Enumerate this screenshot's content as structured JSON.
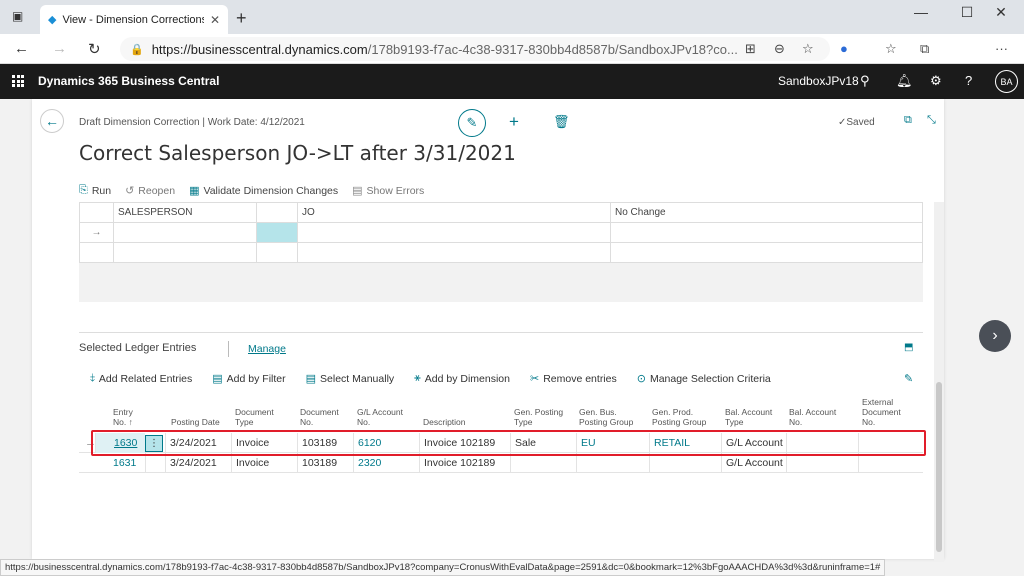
{
  "browser": {
    "tab_title": "View - Dimension Corrections - D",
    "url_host": "https://businesscentral.dynamics.com",
    "url_rest": "/178b9193-f7ac-4c38-9317-830bb4d8587b/SandboxJPv18?co..."
  },
  "app": {
    "name": "Dynamics 365 Business Central",
    "environment": "SandboxJPv18",
    "user_initials": "BA"
  },
  "page": {
    "breadcrumb": "Draft Dimension Correction | Work Date: 4/12/2021",
    "title": "Correct Salesperson JO->LT after 3/31/2021",
    "status": "✓Saved"
  },
  "actions": {
    "run": "Run",
    "reopen": "Reopen",
    "validate": "Validate Dimension Changes",
    "show_errors": "Show Errors"
  },
  "dimension_grid": {
    "rows": [
      {
        "code": "SALESPERSON",
        "value": "JO",
        "new_value": "No Change"
      }
    ]
  },
  "ledger": {
    "title": "Selected Ledger Entries",
    "manage": "Manage",
    "actions": {
      "add_related": "Add Related Entries",
      "add_filter": "Add by Filter",
      "select_manually": "Select Manually",
      "add_dimension": "Add by Dimension",
      "remove": "Remove entries",
      "manage_criteria": "Manage Selection Criteria"
    },
    "columns": {
      "entry_no_1": "Entry",
      "entry_no_2": "No. ↑",
      "posting_date": "Posting Date",
      "doc_type_1": "Document",
      "doc_type_2": "Type",
      "doc_no_1": "Document",
      "doc_no_2": "No.",
      "gl_acc_1": "G/L Account",
      "gl_acc_2": "No.",
      "description": "Description",
      "gen_post_1": "Gen. Posting",
      "gen_post_2": "Type",
      "gen_bus_1": "Gen. Bus.",
      "gen_bus_2": "Posting Group",
      "gen_prod_1": "Gen. Prod.",
      "gen_prod_2": "Posting Group",
      "bal_type_1": "Bal. Account",
      "bal_type_2": "Type",
      "bal_no_1": "Bal. Account",
      "bal_no_2": "No.",
      "ext_doc_1": "External",
      "ext_doc_2": "Document",
      "ext_doc_3": "No."
    },
    "rows": [
      {
        "entry_no": "1630",
        "posting_date": "3/24/2021",
        "doc_type": "Invoice",
        "doc_no": "103189",
        "gl_account": "6120",
        "description": "Invoice 102189",
        "gen_posting_type": "Sale",
        "gen_bus": "EU",
        "gen_prod": "RETAIL",
        "bal_type": "G/L Account"
      },
      {
        "entry_no": "1631",
        "posting_date": "3/24/2021",
        "doc_type": "Invoice",
        "doc_no": "103189",
        "gl_account": "2320",
        "description": "Invoice 102189",
        "gen_posting_type": "",
        "gen_bus": "",
        "gen_prod": "",
        "bal_type": "G/L Account"
      }
    ]
  },
  "statusbar": "https://businesscentral.dynamics.com/178b9193-f7ac-4c38-9317-830bb4d8587b/SandboxJPv18?company=CronusWithEvalData&page=2591&dc=0&bookmark=12%3bFgoAAACHDA%3d%3d&runinframe=1#",
  "icons": [
    "refresh-icon",
    "pencil-icon",
    "trash-icon",
    "search-icon",
    "bell-icon",
    "gear-icon",
    "help-icon"
  ]
}
